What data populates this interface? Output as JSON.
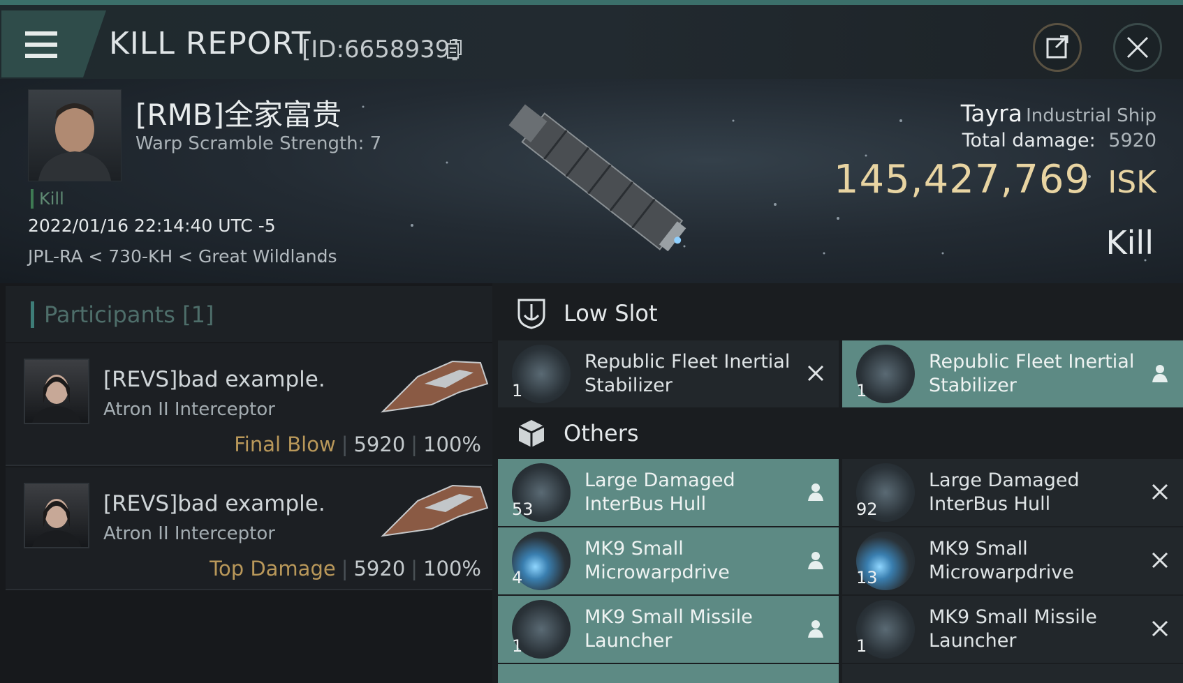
{
  "header": {
    "title": "KILL REPORT",
    "id_text": "[ID:6658939]"
  },
  "victim": {
    "name": "[RMB]全家富贵",
    "subtitle": "Warp Scramble Strength: 7",
    "tag": "Kill",
    "datetime": "2022/01/16 22:14:40 UTC -5",
    "location": "JPL-RA < 730-KH < Great Wildlands",
    "ship_name": "Tayra",
    "ship_class": "Industrial Ship",
    "damage_label": "Total damage:",
    "damage_value": "5920",
    "isk_value": "145,427,769",
    "isk_unit": "ISK",
    "result": "Kill"
  },
  "participants": {
    "title": "Participants [1]",
    "items": [
      {
        "name": "[REVS]bad example.",
        "ship": "Atron II Interceptor",
        "role": "Final Blow",
        "damage": "5920",
        "percent": "100%"
      },
      {
        "name": "[REVS]bad example.",
        "ship": "Atron II Interceptor",
        "role": "Top Damage",
        "damage": "5920",
        "percent": "100%"
      }
    ]
  },
  "sections": {
    "low_slot": {
      "title": "Low Slot"
    },
    "others": {
      "title": "Others"
    }
  },
  "low_slot_items": [
    {
      "name": "Republic Fleet Inertial Stabilizer",
      "qty": "1",
      "state": "destroyed"
    },
    {
      "name": "Republic Fleet Inertial Stabilizer",
      "qty": "1",
      "state": "dropped"
    }
  ],
  "other_items": [
    {
      "name": "Large Damaged InterBus Hull",
      "qty": "53",
      "state": "dropped"
    },
    {
      "name": "Large Damaged InterBus Hull",
      "qty": "92",
      "state": "destroyed"
    },
    {
      "name": "MK9 Small Microwarpdrive",
      "qty": "4",
      "state": "dropped"
    },
    {
      "name": "MK9 Small Microwarpdrive",
      "qty": "13",
      "state": "destroyed"
    },
    {
      "name": "MK9 Small Missile Launcher",
      "qty": "1",
      "state": "dropped"
    },
    {
      "name": "MK9 Small Missile Launcher",
      "qty": "1",
      "state": "destroyed"
    }
  ],
  "colors": {
    "accent": "#3e7d78",
    "dropped_bg": "#5d8a84",
    "isk": "#e8d4a2",
    "role": "#b9985a"
  }
}
